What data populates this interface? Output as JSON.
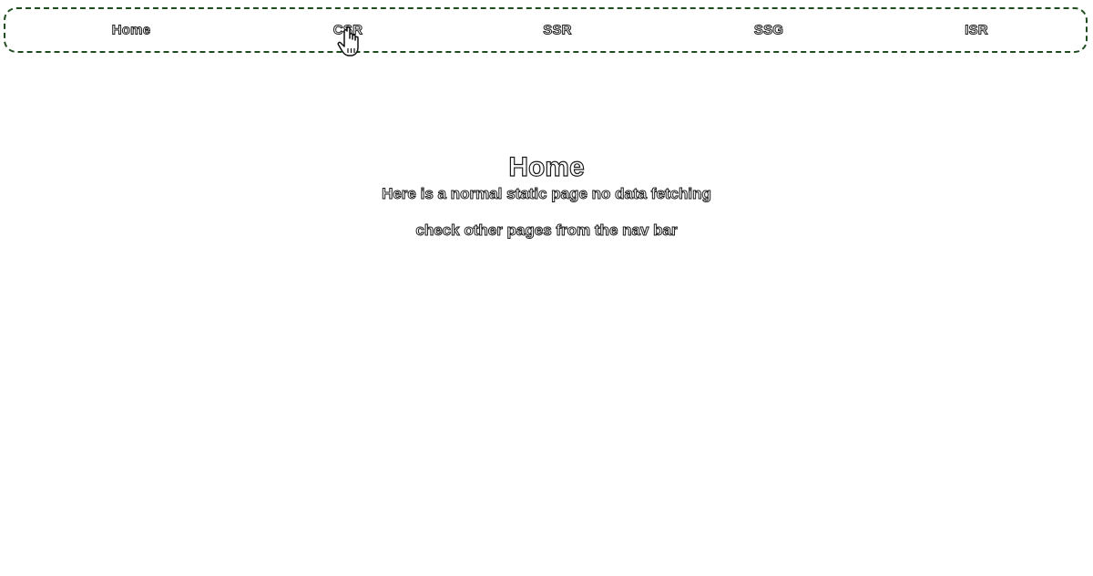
{
  "nav": {
    "items": [
      {
        "label": "Home"
      },
      {
        "label": "CSR"
      },
      {
        "label": "SSR"
      },
      {
        "label": "SSG"
      },
      {
        "label": "ISR"
      }
    ]
  },
  "main": {
    "title": "Home",
    "subtitle": "Here is a normal static page no data fetching",
    "hint": "check other pages from the nav bar"
  },
  "colors": {
    "nav_border": "#1f4d1f",
    "text_outline": "#1a1a1a",
    "background": "#ffffff"
  },
  "icons": {
    "cursor": "hand-pointer-icon"
  }
}
